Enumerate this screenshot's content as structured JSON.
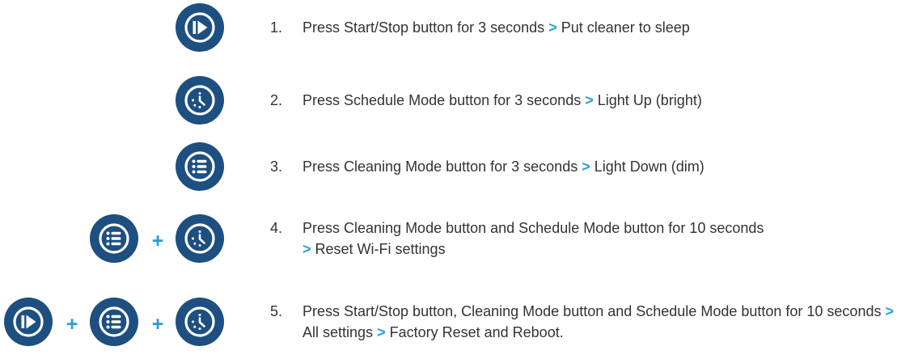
{
  "colors": {
    "button": "#1d4f80",
    "accent": "#2a9dd8",
    "text": "#333333"
  },
  "icons": {
    "start_stop": "play-pause-icon",
    "schedule": "clock-icon",
    "cleaning": "list-icon"
  },
  "plus_symbol": "+",
  "arrow_symbol": ">",
  "steps": [
    {
      "number": "1.",
      "part1": "Press Start/Stop button for 3 seconds",
      "part2": "Put cleaner to sleep"
    },
    {
      "number": "2.",
      "part1": "Press Schedule Mode button for 3 seconds",
      "part2": "Light Up (bright)"
    },
    {
      "number": "3.",
      "part1": "Press Cleaning Mode button for 3 seconds",
      "part2": "Light Down (dim)"
    },
    {
      "number": "4.",
      "part1": "Press Cleaning Mode button and Schedule Mode button for 10 seconds",
      "part2": "Reset Wi-Fi settings"
    },
    {
      "number": "5.",
      "part1": "Press Start/Stop button, Cleaning Mode button and Schedule Mode button for 10 seconds",
      "part2": "All settings",
      "part3": "Factory Reset and Reboot."
    }
  ]
}
